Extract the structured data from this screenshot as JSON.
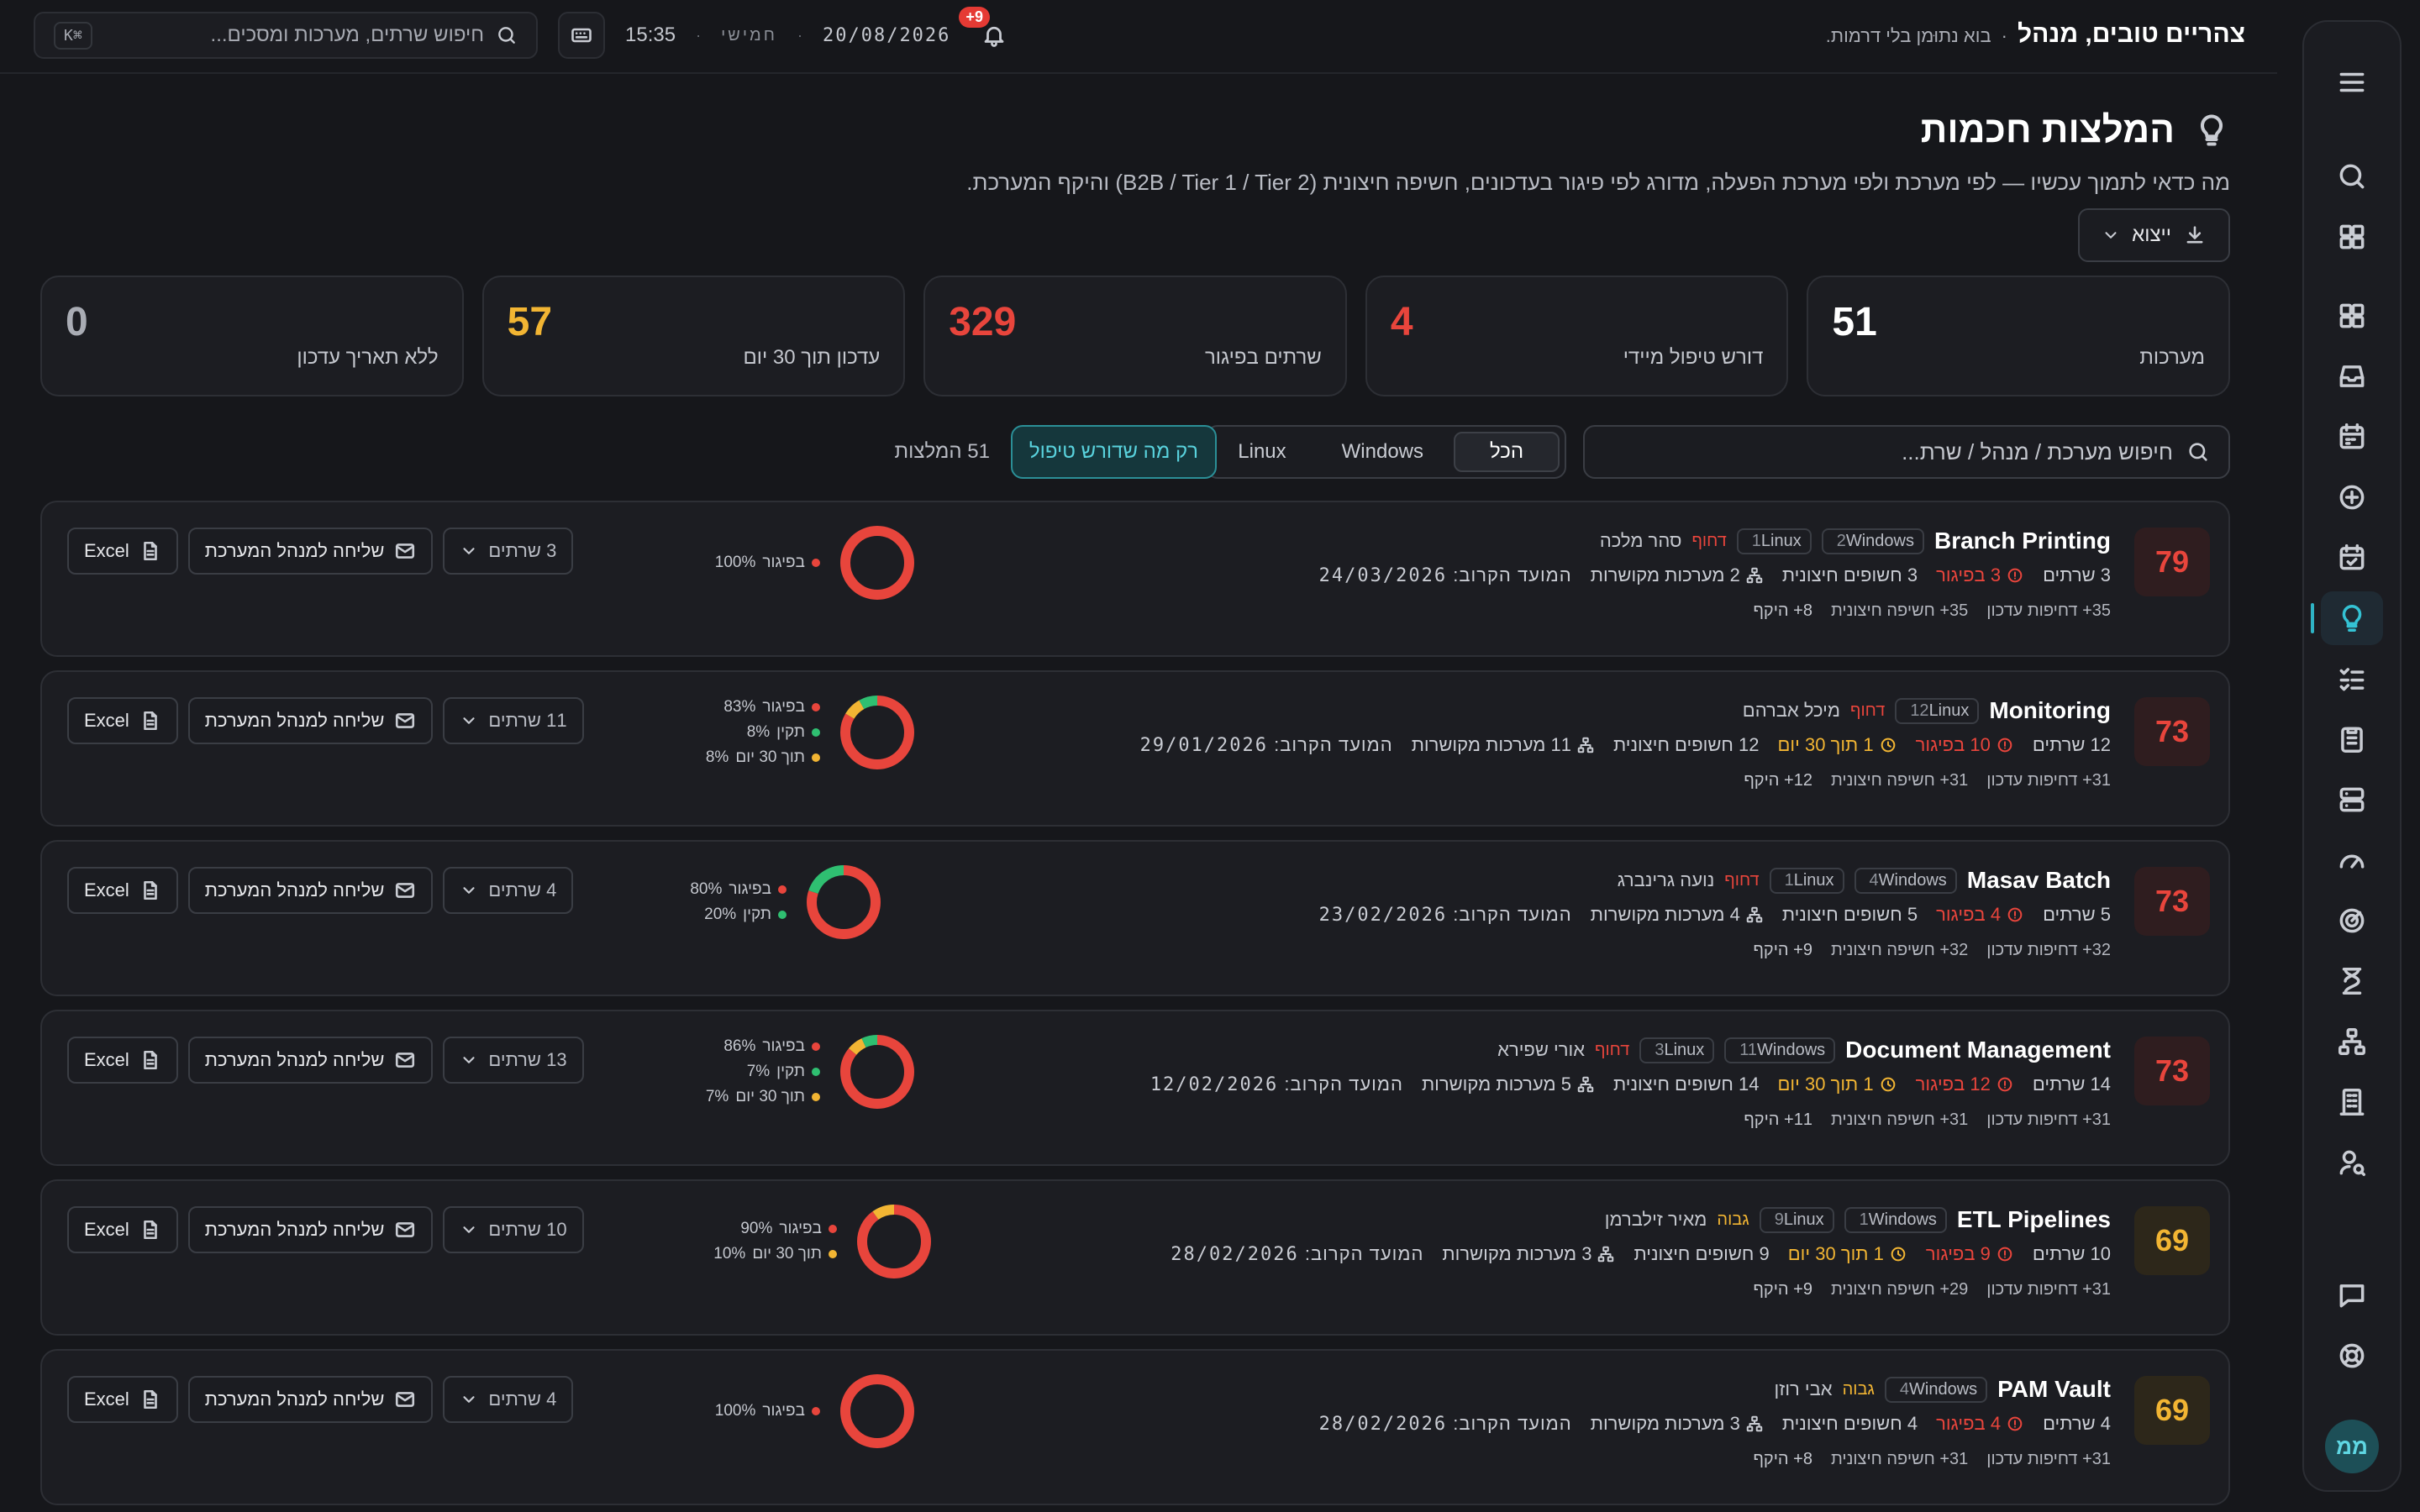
{
  "topbar": {
    "greeting": "צהריים טובים, מנהל",
    "tagline": "בוא נתוּמן בלי דרמות.",
    "search_placeholder": "חיפוש שרתים, מערכות ומסכים...",
    "search_shortcut": "⌘K",
    "time": "15:35",
    "day": "חמישי",
    "date": "20/08/2026",
    "notifications": "9+"
  },
  "header": {
    "title": "המלצות חכמות",
    "subtitle": "מה כדאי לתמוך עכשיו — לפי מערכת ולפי מערכת הפעלה, מדורג לפי פיגור בעדכונים, חשיפה חיצונית (B2B / Tier 1 / Tier 2) והיקף המערכת.",
    "export_label": "ייצוא"
  },
  "stats": [
    {
      "value": "51",
      "label": "מערכות",
      "color": "#ffffff"
    },
    {
      "value": "4",
      "label": "דורש טיפול מיידי",
      "color": "#e8453c"
    },
    {
      "value": "329",
      "label": "שרתים בפיגור",
      "color": "#e8453c"
    },
    {
      "value": "57",
      "label": "עדכון תוך 30 יום",
      "color": "#f2b533"
    },
    {
      "value": "0",
      "label": "ללא תאריך עדכון",
      "color": "#a9acb4"
    }
  ],
  "filters": {
    "search_placeholder": "חיפוש מערכת / מנהל / שרת...",
    "seg_all": "הכל",
    "seg_windows": "Windows",
    "seg_linux": "Linux",
    "needs_action": "רק מה שדורש טיפול",
    "count_label": "51 המלצות"
  },
  "cards": [
    {
      "score": "79",
      "score_level": "red",
      "name": "Branch Printing",
      "chips": [
        {
          "n": "2",
          "os": "Windows"
        },
        {
          "n": "1",
          "os": "Linux"
        }
      ],
      "priority": "דחוף",
      "priority_level": "red",
      "owner": "סהר מלכה",
      "servers": "3 שרתים",
      "behind": "3 בפיגור",
      "soon": "",
      "exposed": "3 חשופים חיצונית",
      "linked": "2 מערכות מקושרות",
      "due_label": "המועד הקרוב:",
      "due_date": "24/03/2026",
      "urgency": "35+ דחיפות עדכון",
      "exposure": "35+ חשיפה חיצונית",
      "scope": "8+ היקף",
      "legend": [
        {
          "label": "בפיגור",
          "pct": "100%",
          "color": "#e8453c"
        }
      ],
      "donut": [
        {
          "frac": 1.0,
          "color": "#e8453c"
        }
      ],
      "server_count": "3 שרתים"
    },
    {
      "score": "73",
      "score_level": "red",
      "name": "Monitoring",
      "chips": [
        {
          "n": "12",
          "os": "Linux"
        }
      ],
      "priority": "דחוף",
      "priority_level": "red",
      "owner": "מיכל אברהם",
      "servers": "12 שרתים",
      "behind": "10 בפיגור",
      "soon": "1 תוך 30 יום",
      "exposed": "12 חשופים חיצונית",
      "linked": "11 מערכות מקושרות",
      "due_label": "המועד הקרוב:",
      "due_date": "29/01/2026",
      "urgency": "31+ דחיפות עדכון",
      "exposure": "31+ חשיפה חיצונית",
      "scope": "12+ היקף",
      "legend": [
        {
          "label": "בפיגור",
          "pct": "83%",
          "color": "#e8453c"
        },
        {
          "label": "תקין",
          "pct": "8%",
          "color": "#2fbf71"
        },
        {
          "label": "תוך 30 יום",
          "pct": "8%",
          "color": "#f2b533"
        }
      ],
      "donut": [
        {
          "frac": 0.834,
          "color": "#e8453c"
        },
        {
          "frac": 0.083,
          "color": "#f2b533"
        },
        {
          "frac": 0.083,
          "color": "#2fbf71"
        }
      ],
      "server_count": "11 שרתים"
    },
    {
      "score": "73",
      "score_level": "red",
      "name": "Masav Batch",
      "chips": [
        {
          "n": "4",
          "os": "Windows"
        },
        {
          "n": "1",
          "os": "Linux"
        }
      ],
      "priority": "דחוף",
      "priority_level": "red",
      "owner": "נועה גרינברג",
      "servers": "5 שרתים",
      "behind": "4 בפיגור",
      "soon": "",
      "exposed": "5 חשופים חיצונית",
      "linked": "4 מערכות מקושרות",
      "due_label": "המועד הקרוב:",
      "due_date": "23/02/2026",
      "urgency": "32+ דחיפות עדכון",
      "exposure": "32+ חשיפה חיצונית",
      "scope": "9+ היקף",
      "legend": [
        {
          "label": "בפיגור",
          "pct": "80%",
          "color": "#e8453c"
        },
        {
          "label": "תקין",
          "pct": "20%",
          "color": "#2fbf71"
        }
      ],
      "donut": [
        {
          "frac": 0.8,
          "color": "#e8453c"
        },
        {
          "frac": 0.2,
          "color": "#2fbf71"
        }
      ],
      "server_count": "4 שרתים"
    },
    {
      "score": "73",
      "score_level": "red",
      "name": "Document Management",
      "chips": [
        {
          "n": "11",
          "os": "Windows"
        },
        {
          "n": "3",
          "os": "Linux"
        }
      ],
      "priority": "דחוף",
      "priority_level": "red",
      "owner": "אורי שפירא",
      "servers": "14 שרתים",
      "behind": "12 בפיגור",
      "soon": "1 תוך 30 יום",
      "exposed": "14 חשופים חיצונית",
      "linked": "5 מערכות מקושרות",
      "due_label": "המועד הקרוב:",
      "due_date": "12/02/2026",
      "urgency": "31+ דחיפות עדכון",
      "exposure": "31+ חשיפה חיצונית",
      "scope": "11+ היקף",
      "legend": [
        {
          "label": "בפיגור",
          "pct": "86%",
          "color": "#e8453c"
        },
        {
          "label": "תקין",
          "pct": "7%",
          "color": "#2fbf71"
        },
        {
          "label": "תוך 30 יום",
          "pct": "7%",
          "color": "#f2b533"
        }
      ],
      "donut": [
        {
          "frac": 0.858,
          "color": "#e8453c"
        },
        {
          "frac": 0.071,
          "color": "#f2b533"
        },
        {
          "frac": 0.071,
          "color": "#2fbf71"
        }
      ],
      "server_count": "13 שרתים"
    },
    {
      "score": "69",
      "score_level": "amber",
      "name": "ETL Pipelines",
      "chips": [
        {
          "n": "1",
          "os": "Windows"
        },
        {
          "n": "9",
          "os": "Linux"
        }
      ],
      "priority": "גבוה",
      "priority_level": "amber",
      "owner": "מאיר זילברמן",
      "servers": "10 שרתים",
      "behind": "9 בפיגור",
      "soon": "1 תוך 30 יום",
      "exposed": "9 חשופים חיצונית",
      "linked": "3 מערכות מקושרות",
      "due_label": "המועד הקרוב:",
      "due_date": "28/02/2026",
      "urgency": "31+ דחיפות עדכון",
      "exposure": "29+ חשיפה חיצונית",
      "scope": "9+ היקף",
      "legend": [
        {
          "label": "בפיגור",
          "pct": "90%",
          "color": "#e8453c"
        },
        {
          "label": "תוך 30 יום",
          "pct": "10%",
          "color": "#f2b533"
        }
      ],
      "donut": [
        {
          "frac": 0.9,
          "color": "#e8453c"
        },
        {
          "frac": 0.1,
          "color": "#f2b533"
        }
      ],
      "server_count": "10 שרתים"
    },
    {
      "score": "69",
      "score_level": "amber",
      "name": "PAM Vault",
      "chips": [
        {
          "n": "4",
          "os": "Windows"
        }
      ],
      "priority": "גבוה",
      "priority_level": "amber",
      "owner": "אבי רוזן",
      "servers": "4 שרתים",
      "behind": "4 בפיגור",
      "soon": "",
      "exposed": "4 חשופים חיצונית",
      "linked": "3 מערכות מקושרות",
      "due_label": "המועד הקרוב:",
      "due_date": "28/02/2026",
      "urgency": "31+ דחיפות עדכון",
      "exposure": "31+ חשיפה חיצונית",
      "scope": "8+ היקף",
      "legend": [
        {
          "label": "בפיגור",
          "pct": "100%",
          "color": "#e8453c"
        }
      ],
      "donut": [
        {
          "frac": 1.0,
          "color": "#e8453c"
        }
      ],
      "server_count": "4 שרתים"
    }
  ],
  "card_actions": {
    "excel": "Excel",
    "send": "שליחה למנהל המערכת"
  },
  "sidebar": {
    "avatar": "ממ",
    "icons": [
      "menu-icon",
      "search-icon",
      "apps-grid-icon",
      "dashboard-icon",
      "inbox-icon",
      "calendar-icon",
      "add-circle-icon",
      "calendar-check-icon",
      "lightbulb-icon",
      "checklist-icon",
      "clipboard-icon",
      "server-icon",
      "gauge-icon",
      "radar-icon",
      "hourglass-icon",
      "sitemap-icon",
      "building-icon",
      "user-search-icon"
    ]
  }
}
